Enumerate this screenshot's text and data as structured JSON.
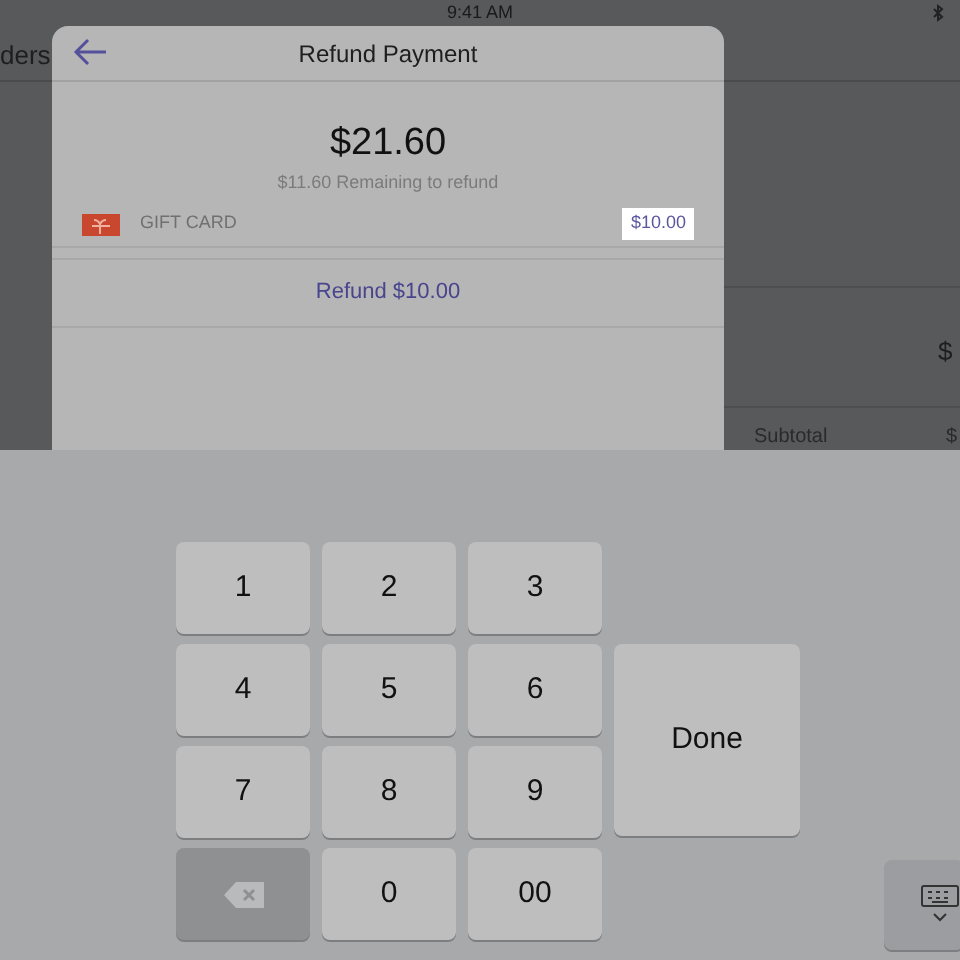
{
  "status_bar": {
    "time": "9:41 AM"
  },
  "background": {
    "nav_title": "ders",
    "amount": "$",
    "subtotal_label": "Subtotal",
    "subtotal_value": "$"
  },
  "modal": {
    "title": "Refund Payment",
    "total": "$21.60",
    "remaining": "$11.60 Remaining to refund",
    "tender": {
      "label": "GIFT CARD",
      "value": "$10.00",
      "focused": true
    },
    "refund_button": "Refund $10.00"
  },
  "keypad": {
    "keys": [
      {
        "kind": "digit",
        "label": "1"
      },
      {
        "kind": "digit",
        "label": "2"
      },
      {
        "kind": "digit",
        "label": "3"
      },
      {
        "kind": "digit",
        "label": "4"
      },
      {
        "kind": "digit",
        "label": "5"
      },
      {
        "kind": "digit",
        "label": "6"
      },
      {
        "kind": "digit",
        "label": "7"
      },
      {
        "kind": "digit",
        "label": "8"
      },
      {
        "kind": "digit",
        "label": "9"
      },
      {
        "kind": "delete"
      },
      {
        "kind": "digit",
        "label": "0"
      },
      {
        "kind": "digit",
        "label": "00"
      }
    ],
    "done": "Done"
  }
}
